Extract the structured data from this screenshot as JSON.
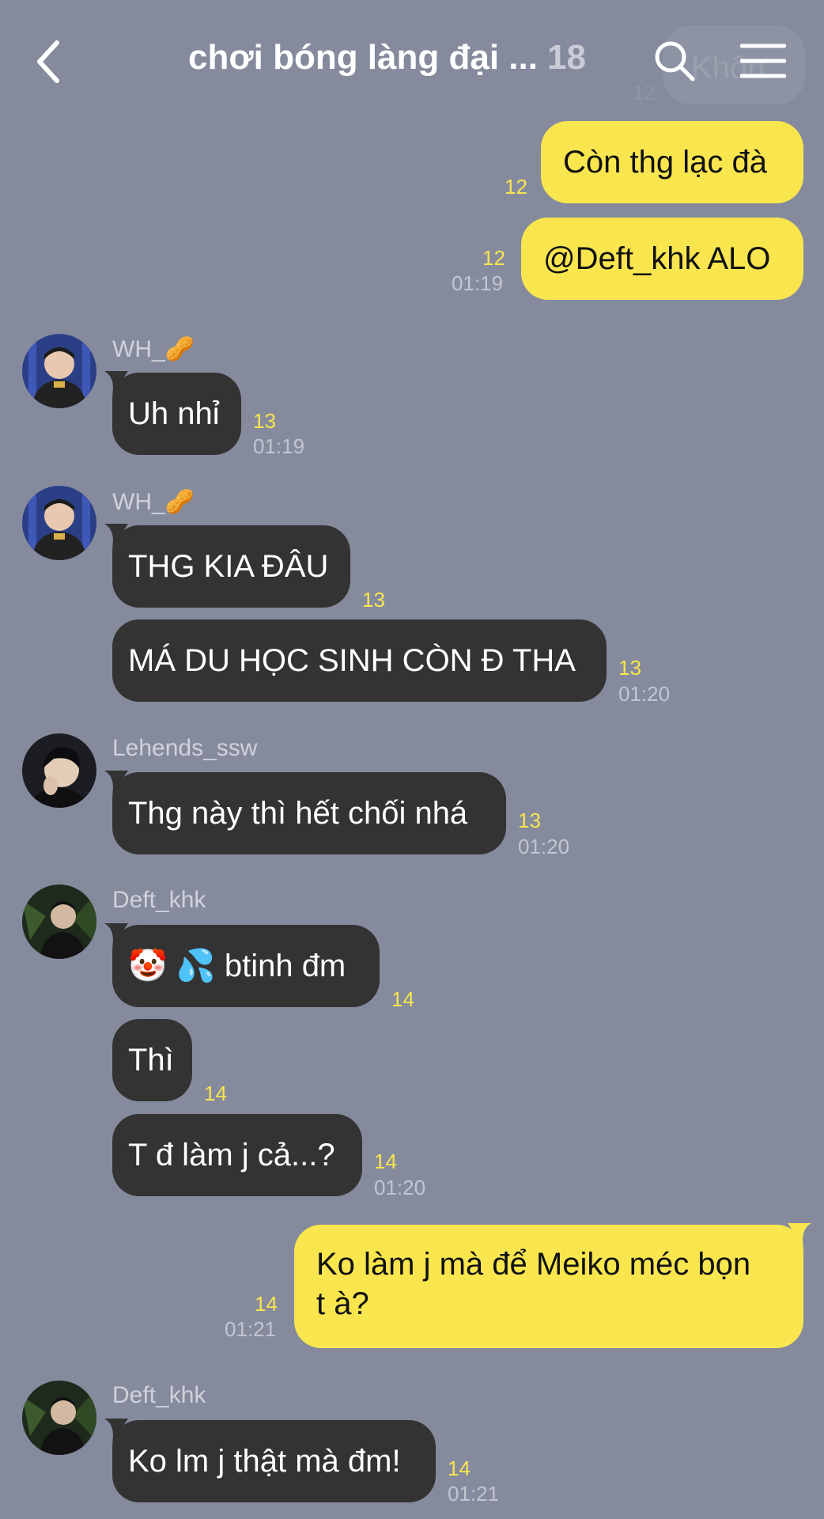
{
  "header": {
    "title": "chơi bóng làng đại ...",
    "member_count": "18",
    "back_icon": "chevron-left-icon",
    "search_icon": "search-icon",
    "menu_icon": "hamburger-menu-icon"
  },
  "ghost": {
    "text": "Khôn",
    "num": "12"
  },
  "colors": {
    "background": "#858b9d",
    "my_bubble": "#f9e64f",
    "their_bubble": "#333334",
    "read_count": "#f9e64f"
  },
  "messages": {
    "m1": {
      "text": "Còn thg lạc đà",
      "num": "12"
    },
    "m2": {
      "text": "@Deft_khk ALO",
      "num": "12",
      "time": "01:19"
    },
    "g1": {
      "sender": "WH_🥜",
      "text": "Uh nhỉ",
      "num": "13",
      "time": "01:19"
    },
    "g2": {
      "sender": "WH_🥜",
      "text": "THG KIA ĐÂU",
      "num": "13"
    },
    "g3": {
      "text": "MÁ DU HỌC SINH CÒN Đ THA",
      "num": "13",
      "time": "01:20"
    },
    "g4": {
      "sender": "Lehends_ssw",
      "text": "Thg này thì hết chối nhá",
      "num": "13",
      "time": "01:20"
    },
    "g5": {
      "sender": "Deft_khk",
      "text": "🤡 💦 btinh đm",
      "num": "14"
    },
    "g6": {
      "text": "Thì",
      "num": "14"
    },
    "g7": {
      "text": "T đ làm j cả...?",
      "num": "14",
      "time": "01:20"
    },
    "m3": {
      "line1": "Ko làm j mà để Meiko méc bọn",
      "line2": "t à?",
      "num": "14",
      "time": "01:21"
    },
    "g8": {
      "sender": "Deft_khk",
      "text": "Ko lm j thật mà đm!",
      "num": "14",
      "time": "01:21"
    }
  }
}
